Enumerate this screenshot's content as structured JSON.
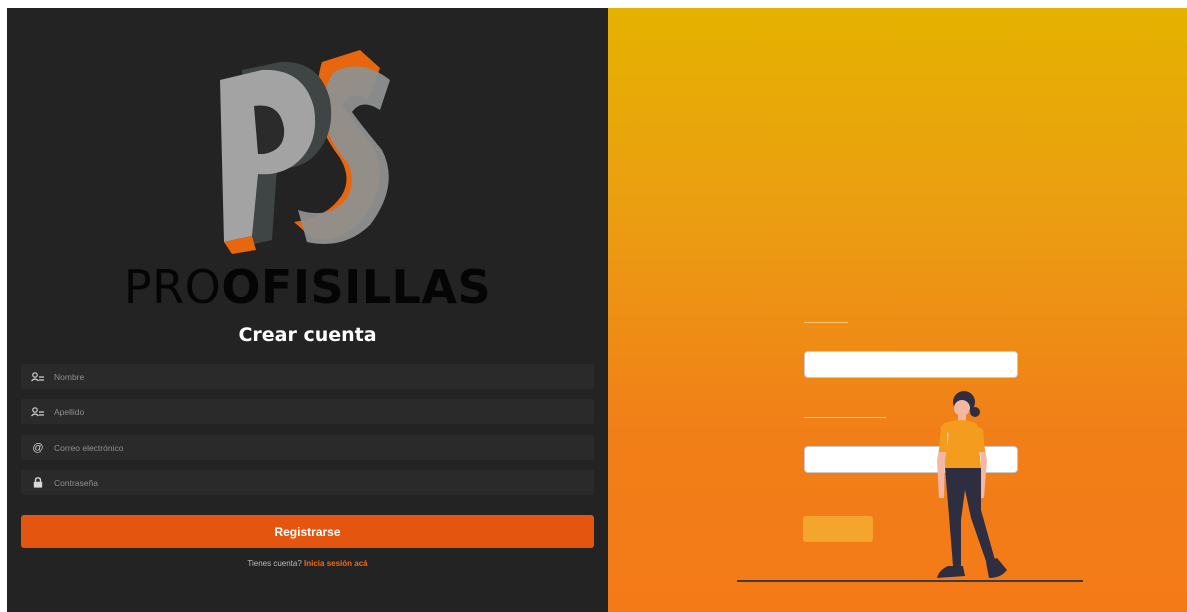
{
  "brand": {
    "light": "PRO",
    "heavy": "OFISILLAS"
  },
  "form": {
    "heading": "Crear cuenta",
    "fields": [
      {
        "icon": "user-icon",
        "placeholder": "Nombre"
      },
      {
        "icon": "user-icon",
        "placeholder": "Apellido"
      },
      {
        "icon": "at-icon",
        "placeholder": "Correo electrónico"
      },
      {
        "icon": "lock-icon",
        "placeholder": "Contraseña"
      }
    ],
    "submit_label": "Registrarse",
    "footer_text": "Tienes cuenta?",
    "footer_link": "Inicia sesión acá"
  },
  "colors": {
    "panel": "#232323",
    "accent": "#e4560f",
    "gradient_top": "#e5b200",
    "gradient_bottom": "#f47a18"
  }
}
